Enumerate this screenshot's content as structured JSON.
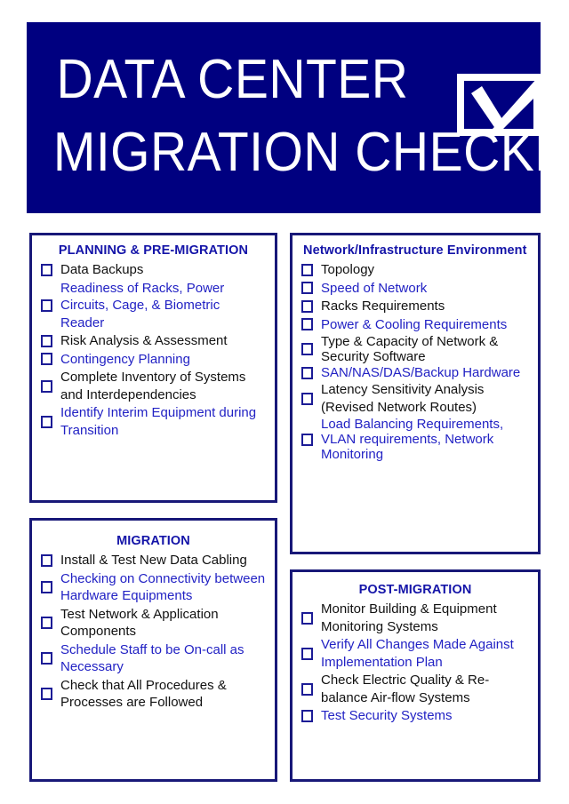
{
  "document": {
    "title_line_1": "DATA CENTER",
    "title_line_2": "MIGRATION CHECKLIST",
    "header_icon": "checked-checkbox-icon",
    "colors": {
      "banner_background": "#000080",
      "banner_text": "#ffffff",
      "panel_border": "#181878",
      "heading_text": "#1414a8",
      "item_text_black": "#111111",
      "item_text_blue": "#2222c4",
      "checkbox_border": "#1c1c96",
      "page_background": "#ffffff"
    }
  },
  "panels": {
    "planning": {
      "heading": "PLANNING & PRE-MIGRATION",
      "heading_align": "center",
      "items": [
        {
          "label": "Data Backups",
          "color": "black",
          "tight": false
        },
        {
          "label": "Readiness of Racks, Power Circuits, Cage, & Biometric Reader",
          "color": "blue",
          "tight": false
        },
        {
          "label": "Risk Analysis & Assessment",
          "color": "black",
          "tight": false
        },
        {
          "label": "Contingency Planning",
          "color": "blue",
          "tight": false
        },
        {
          "label": "Complete Inventory of Systems and Interdependencies",
          "color": "black",
          "tight": false
        },
        {
          "label": "Identify Interim Equipment during Transition",
          "color": "blue",
          "tight": false
        }
      ]
    },
    "network": {
      "heading": "Network/Infrastructure Environment",
      "heading_align": "left",
      "items": [
        {
          "label": "Topology",
          "color": "black",
          "tight": false
        },
        {
          "label": "Speed of Network",
          "color": "blue",
          "tight": false
        },
        {
          "label": "Racks Requirements",
          "color": "black",
          "tight": false
        },
        {
          "label": "Power & Cooling Requirements",
          "color": "blue",
          "tight": false
        },
        {
          "label": "Type & Capacity of Network & Security Software",
          "color": "black",
          "tight": true
        },
        {
          "label": "SAN/NAS/DAS/Backup Hardware",
          "color": "blue",
          "tight": true
        },
        {
          "label": "Latency Sensitivity Analysis (Revised Network Routes)",
          "color": "black",
          "tight": false
        },
        {
          "label": "Load Balancing Requirements, VLAN requirements, Network Monitoring",
          "color": "blue",
          "tight": true
        }
      ]
    },
    "migration": {
      "heading": "MIGRATION",
      "heading_align": "center",
      "items": [
        {
          "label": "Install & Test New Data Cabling",
          "color": "black",
          "tight": false
        },
        {
          "label": "Checking on Connectivity between Hardware Equipments",
          "color": "blue",
          "tight": false
        },
        {
          "label": "Test Network & Application Components",
          "color": "black",
          "tight": false
        },
        {
          "label": "Schedule Staff to be On-call as Necessary",
          "color": "blue",
          "tight": false
        },
        {
          "label": "Check that All Procedures & Processes are Followed",
          "color": "black",
          "tight": false
        }
      ]
    },
    "post_migration": {
      "heading": "POST-MIGRATION",
      "heading_align": "center",
      "items": [
        {
          "label": "Monitor Building & Equipment Monitoring Systems",
          "color": "black",
          "tight": false
        },
        {
          "label": "Verify All Changes Made Against Implementation Plan",
          "color": "blue",
          "tight": false
        },
        {
          "label": "Check Electric Quality & Re-balance Air-flow Systems",
          "color": "black",
          "tight": false
        },
        {
          "label": "Test Security Systems",
          "color": "blue",
          "tight": false
        }
      ]
    }
  }
}
